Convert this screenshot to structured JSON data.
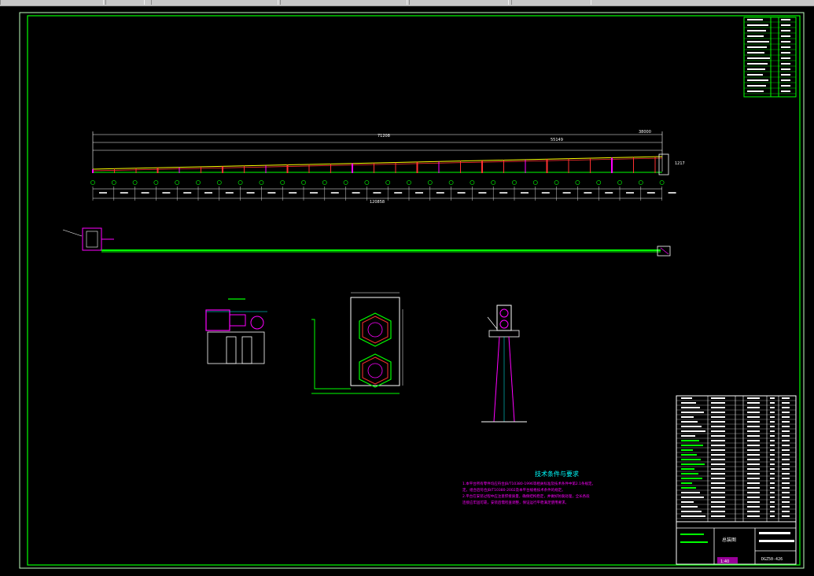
{
  "toolbar": {
    "segments": 6
  },
  "drawing": {
    "notes_title": "技术条件与要求",
    "notes_line1": "1.本平台所有零件均应符合JB/T10380-1996等相关标准及技术条件中第2.1条规定。",
    "notes_line2": "定。组合后符合JB/T10380-2002及本平台规格技术条件的规定。",
    "notes_line3": "2.平台在安装过程中应注意焊接质量，确保结构稳定，并做好防腐处理，全长各段",
    "notes_line4": "连接应牢固可靠，安装后需检查调整，保证运行平稳满足使用要求。",
    "title_block_name": "总装图",
    "drawing_number": "DGZ50-426",
    "scale_label": "1:40",
    "overall_dim": "120858",
    "top_dim": "71208",
    "top_dim2": "55149",
    "right_dim": "38000",
    "height_dim": "1217",
    "colors": {
      "frame": "#00ff00",
      "magenta": "#ff00ff",
      "red": "#ff3030",
      "white": "#ffffff",
      "yellow": "#ffff00",
      "cyan": "#00ffff"
    }
  }
}
